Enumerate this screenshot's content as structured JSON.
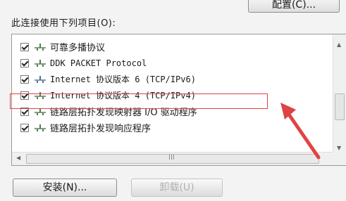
{
  "header": {
    "configure_button": "配置(C)..."
  },
  "section_label": "此连接使用下列项目(O):",
  "items": [
    {
      "label": "可靠多播协议",
      "checked": true,
      "icon": "network-protocol-icon"
    },
    {
      "label": "DDK PACKET Protocol",
      "checked": true,
      "icon": "network-protocol-icon"
    },
    {
      "label": "Internet 协议版本 6 (TCP/IPv6)",
      "checked": true,
      "icon": "network-protocol-icon"
    },
    {
      "label": "Internet 协议版本 4 (TCP/IPv4)",
      "checked": true,
      "icon": "network-protocol-icon"
    },
    {
      "label": "链路层拓扑发现映射器 I/O 驱动程序",
      "checked": true,
      "icon": "network-protocol-icon"
    },
    {
      "label": "链路层拓扑发现响应程序",
      "checked": true,
      "icon": "network-protocol-icon"
    }
  ],
  "scroll_grip": "III",
  "buttons": {
    "install": "安装(N)...",
    "uninstall": "卸载(U)"
  },
  "colors": {
    "highlight": "#e04343",
    "arrow": "#e04343"
  }
}
